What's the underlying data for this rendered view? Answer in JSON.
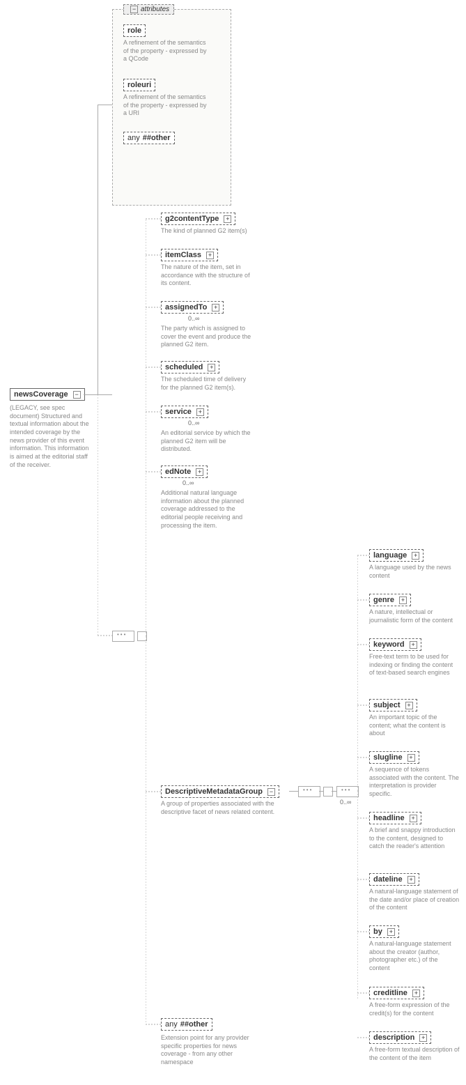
{
  "root": {
    "name": "newsCoverage",
    "desc": "(LEGACY, see spec document) Structured and textual information about the intended coverage by the news provider of this event information. This information is aimed at the editorial staff of the receiver."
  },
  "attributes": {
    "title": "attributes",
    "role": {
      "name": "role",
      "desc": "A refinement of the semantics of the property - expressed by a QCode"
    },
    "roleuri": {
      "name": "roleuri",
      "desc": "A refinement of the semantics of the property - expressed by a URI"
    },
    "any": {
      "prefix": "any",
      "label": "##other"
    }
  },
  "g2": [
    {
      "name": "g2contentType",
      "desc": "The kind of planned G2 item(s)",
      "card": ""
    },
    {
      "name": "itemClass",
      "desc": "The nature of the item, set in accordance with the structure of its content.",
      "card": ""
    },
    {
      "name": "assignedTo",
      "desc": "The party which is assigned to cover the event and produce the planned G2 item.",
      "card": "0..∞"
    },
    {
      "name": "scheduled",
      "desc": "The scheduled time of delivery for the planned G2 item(s).",
      "card": ""
    },
    {
      "name": "service",
      "desc": "An editorial service by which the planned G2 item will be distributed.",
      "card": "0..∞"
    },
    {
      "name": "edNote",
      "desc": "Additional natural language information about the planned coverage addressed to the editorial people receiving and processing the item.",
      "card": "0..∞"
    }
  ],
  "dmg": {
    "name": "DescriptiveMetadataGroup",
    "desc": "A group of properties associated with the descriptive facet of news related content.",
    "card": "0..∞"
  },
  "meta": [
    {
      "name": "language",
      "desc": "A language used by the news content"
    },
    {
      "name": "genre",
      "desc": "A nature, intellectual or journalistic form of the content"
    },
    {
      "name": "keyword",
      "desc": "Free-text term to be used for indexing or finding the content of text-based search engines"
    },
    {
      "name": "subject",
      "desc": "An important topic of the content; what the content is about"
    },
    {
      "name": "slugline",
      "desc": "A sequence of tokens associated with the content. The interpretation is provider specific."
    },
    {
      "name": "headline",
      "desc": "A brief and snappy introduction to the content, designed to catch the reader's attention"
    },
    {
      "name": "dateline",
      "desc": "A natural-language statement of the date and/or place of creation of the content"
    },
    {
      "name": "by",
      "desc": "A natural-language statement about the creator (author, photographer etc.) of the content"
    },
    {
      "name": "creditline",
      "desc": "A free-form expression of the credit(s) for the content"
    },
    {
      "name": "description",
      "desc": "A free-form textual description of the content of the item"
    }
  ],
  "ext": {
    "prefix": "any",
    "label": "##other",
    "desc": "Extension point for any provider specific properties for news coverage - from any other namespace"
  }
}
